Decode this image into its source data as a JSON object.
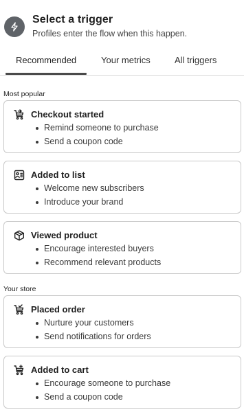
{
  "header": {
    "title": "Select a trigger",
    "subtitle": "Profiles enter the flow when this happen.",
    "icon": "lightning-bolt-icon"
  },
  "tabs": [
    {
      "label": "Recommended",
      "active": true
    },
    {
      "label": "Your metrics",
      "active": false
    },
    {
      "label": "All triggers",
      "active": false
    }
  ],
  "sections": {
    "most_popular": "Most popular",
    "your_store": "Your store"
  },
  "cards": [
    {
      "title": "Checkout started",
      "icon": "cart-arrow-icon",
      "bullets": [
        "Remind someone to purchase",
        "Send a coupon code"
      ]
    },
    {
      "title": "Added to list",
      "icon": "list-contact-icon",
      "bullets": [
        "Welcome new subscribers",
        "Introduce your brand"
      ]
    },
    {
      "title": "Viewed product",
      "icon": "cube-icon",
      "bullets": [
        "Encourage interested buyers",
        "Recommend relevant products"
      ]
    },
    {
      "title": "Placed order",
      "icon": "cart-check-icon",
      "bullets": [
        "Nurture your customers",
        "Send notifications for orders"
      ]
    },
    {
      "title": "Added to cart",
      "icon": "cart-plus-icon",
      "bullets": [
        "Encourage someone to purchase",
        "Send a coupon code"
      ]
    }
  ]
}
